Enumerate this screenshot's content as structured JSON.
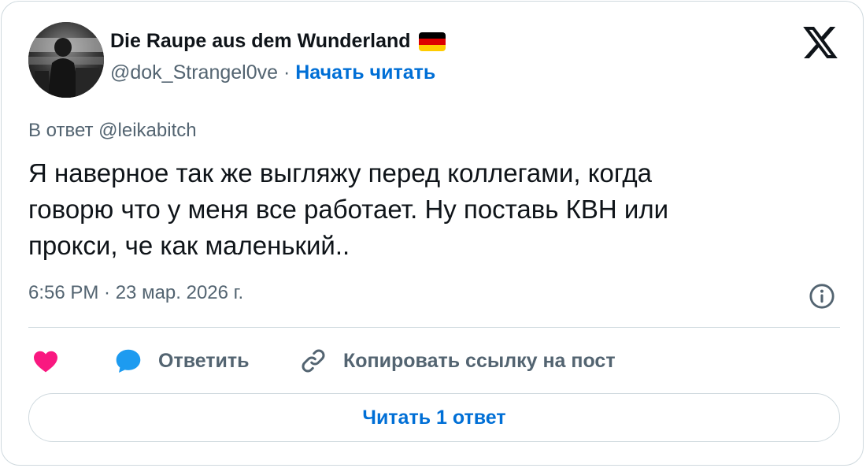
{
  "author": {
    "display_name": "Die Raupe aus dem Wunderland",
    "flag_icon": "germany-flag-icon",
    "handle": "@dok_Strangel0ve",
    "separator": "·",
    "follow_label": "Начать читать"
  },
  "brand_icon": "x-logo-icon",
  "reply_to": "В ответ @leikabitch",
  "tweet": {
    "lines": [
      "Я наверное так же выгляжу перед коллегами, когда",
      "говорю что у меня все работает. Ну поставь КВН или",
      "прокси, че как маленький.."
    ]
  },
  "timestamp": "6:56 PM · 23 мар. 2026 г.",
  "actions": {
    "like_icon": "heart-icon",
    "reply_label": "Ответить",
    "reply_icon": "speech-bubble-icon",
    "copy_link_label": "Копировать ссылку на пост",
    "copy_link_icon": "link-icon"
  },
  "read_replies_label": "Читать 1 ответ",
  "colors": {
    "link_blue": "#006fd6",
    "like_pink": "#f91880",
    "reply_blue": "#1d9bf0",
    "muted_text": "#536471",
    "border": "#cfd9de"
  }
}
